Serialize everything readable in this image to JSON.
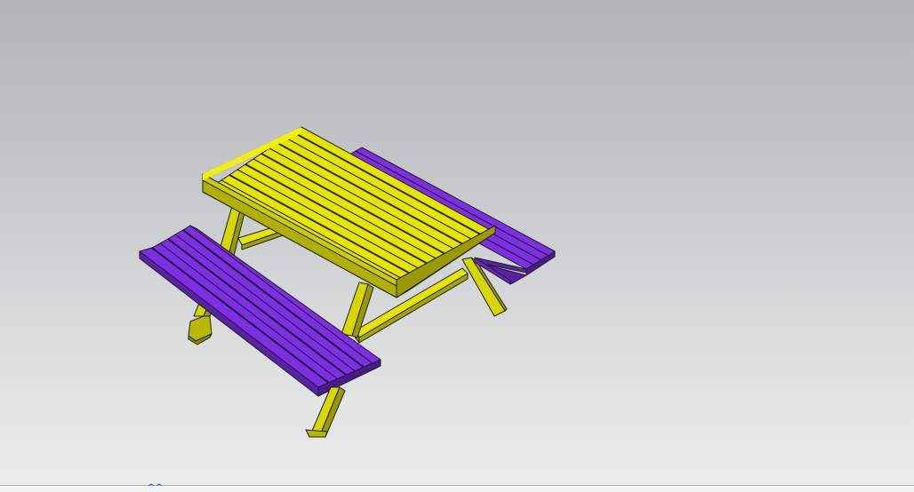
{
  "viewport": {
    "background_top": "#b2b4b7",
    "background_bottom": "#ececec"
  },
  "model": {
    "object": "picnic-table",
    "tabletop_color": "#e5e500",
    "bench_color": "#7e2fe6",
    "edge_color": "#1e1e1e"
  },
  "status_bar": {
    "triad_color": "#3a5bd6"
  }
}
